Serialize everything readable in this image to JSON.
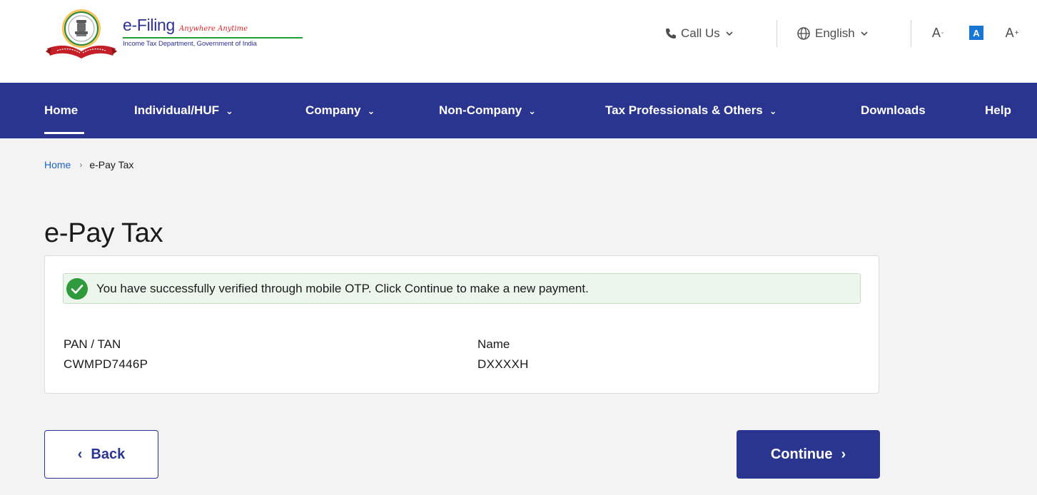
{
  "header": {
    "logo": {
      "emblem_icon": "india-emblem-seal-icon",
      "title": "e-Filing",
      "tagline": "Anywhere Anytime",
      "subtitle": "Income Tax Department, Government of India"
    },
    "call_us": {
      "label": "Call Us",
      "icon": "phone-icon"
    },
    "language": {
      "label": "English",
      "icon": "globe-icon"
    },
    "font_size": {
      "decrease": "A",
      "default": "A",
      "increase": "A",
      "decrease_mark": "-",
      "increase_mark": "+"
    }
  },
  "nav": {
    "items": [
      {
        "label": "Home",
        "dropdown": false,
        "active": true
      },
      {
        "label": "Individual/HUF",
        "dropdown": true
      },
      {
        "label": "Company",
        "dropdown": true
      },
      {
        "label": "Non-Company",
        "dropdown": true
      },
      {
        "label": "Tax Professionals & Others",
        "dropdown": true
      },
      {
        "label": "Downloads",
        "dropdown": false
      },
      {
        "label": "Help",
        "dropdown": false
      }
    ],
    "dropdown_glyph": "⌄"
  },
  "breadcrumb": {
    "home": "Home",
    "separator": "›",
    "current": "e-Pay Tax"
  },
  "page": {
    "title": "e-Pay Tax"
  },
  "card": {
    "alert": {
      "icon": "check-circle-icon",
      "message": "You have successfully verified through mobile OTP. Click Continue to make a new payment."
    },
    "fields": [
      {
        "label": "PAN / TAN",
        "value": "CWMPD7446P"
      },
      {
        "label": "Name",
        "value": "DXXXXH"
      }
    ]
  },
  "actions": {
    "back_label": "Back",
    "back_glyph": "‹",
    "continue_label": "Continue",
    "continue_glyph": "›"
  },
  "colors": {
    "brand_blue": "#2a3590",
    "link_blue": "#1d63c4",
    "success_green": "#2e9a3c",
    "alert_bg": "#edf6ec",
    "page_bg": "#f3f3f3"
  }
}
